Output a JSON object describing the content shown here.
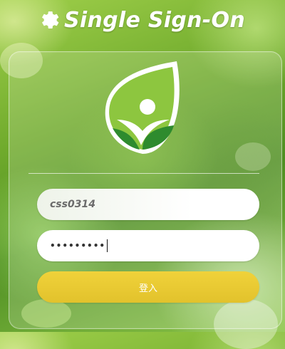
{
  "header": {
    "title": "Single Sign-On",
    "icon": "gear-icon"
  },
  "logo": {
    "icon": "leaf-person-logo",
    "colors": {
      "leaf": "#8dc63f",
      "dark_leaf": "#2e8b2e",
      "head": "#ffffff"
    }
  },
  "form": {
    "username": {
      "value": "css0314"
    },
    "password": {
      "masked_value": "•••••••••"
    },
    "submit_label": "登入"
  },
  "colors": {
    "button": "#e6c52f",
    "title": "#ffffff"
  }
}
